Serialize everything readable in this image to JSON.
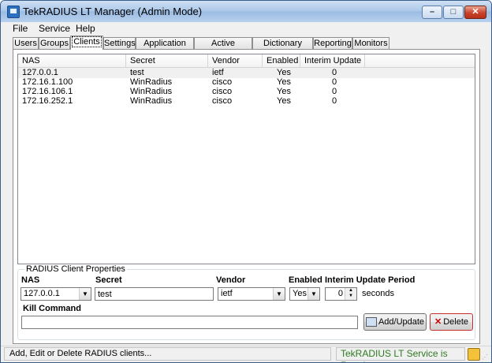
{
  "window": {
    "title": "TekRADIUS LT Manager (Admin Mode)"
  },
  "menu": [
    {
      "label": "File"
    },
    {
      "label": "Service"
    },
    {
      "label": "Help"
    }
  ],
  "tabs": [
    {
      "label": "Users"
    },
    {
      "label": "Groups"
    },
    {
      "label": "Clients",
      "active": true
    },
    {
      "label": "Settings"
    },
    {
      "label": "Application Log"
    },
    {
      "label": "Active Sessions"
    },
    {
      "label": "Dictionary Editor"
    },
    {
      "label": "Reporting"
    },
    {
      "label": "Monitors"
    }
  ],
  "clients": {
    "columns": [
      "NAS",
      "Secret",
      "Vendor",
      "Enabled",
      "Interim Update"
    ],
    "rows": [
      [
        "127.0.0.1",
        "test",
        "ietf",
        "Yes",
        "0"
      ],
      [
        "172.16.1.100",
        "WinRadius",
        "cisco",
        "Yes",
        "0"
      ],
      [
        "172.16.106.1",
        "WinRadius",
        "cisco",
        "Yes",
        "0"
      ],
      [
        "172.16.252.1",
        "WinRadius",
        "cisco",
        "Yes",
        "0"
      ]
    ]
  },
  "props": {
    "group_title": "RADIUS Client Properties",
    "nas_label": "NAS",
    "nas_value": "127.0.0.1",
    "secret_label": "Secret",
    "secret_value": "test",
    "vendor_label": "Vendor",
    "vendor_value": "ietf",
    "enabled_label": "Enabled",
    "enabled_value": "Yes",
    "interim_label": "Interim Update Period",
    "interim_value": "0",
    "interim_unit": "seconds",
    "kill_label": "Kill Command",
    "kill_value": "",
    "add_button": "Add/Update",
    "delete_button": "Delete"
  },
  "status": {
    "left": "Add, Edit or Delete RADIUS clients...",
    "right": "TekRADIUS LT Service is Running"
  }
}
